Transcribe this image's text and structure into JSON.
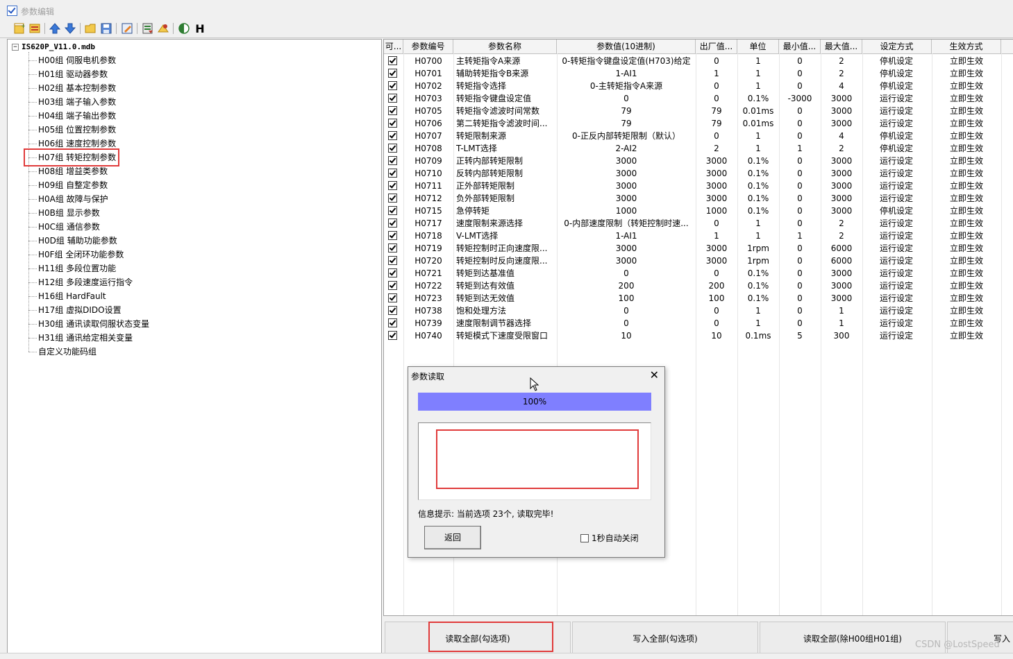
{
  "window": {
    "title": "参数编辑"
  },
  "toolbar": {
    "items": [
      "new-icon",
      "copy-icon",
      "arrow-up-icon",
      "arrow-down-icon",
      "folder-open-icon",
      "save-icon",
      "edit-icon",
      "export-icon",
      "import-icon",
      "contrast-icon"
    ],
    "h_label": "H"
  },
  "tree": {
    "root": "IS620P_V11.0.mdb",
    "expand_glyph": "−",
    "items": [
      "H00组 伺服电机参数",
      "H01组 驱动器参数",
      "H02组 基本控制参数",
      "H03组 端子输入参数",
      "H04组 端子输出参数",
      "H05组 位置控制参数",
      "H06组 速度控制参数",
      "H07组 转矩控制参数",
      "H08组 增益类参数",
      "H09组 自整定参数",
      "H0A组 故障与保护",
      "H0B组 显示参数",
      "H0C组 通信参数",
      "H0D组 辅助功能参数",
      "H0F组 全闭环功能参数",
      "H11组 多段位置功能",
      "H12组 多段速度运行指令",
      "H16组 HardFault",
      "H17组 虚拟DIDO设置",
      "H30组 通讯读取伺服状态变量",
      "H31组 通讯给定相关变量",
      "自定义功能码组"
    ],
    "highlighted_index": 7
  },
  "grid": {
    "headers": [
      "可...",
      "参数编号",
      "参数名称",
      "参数值(10进制)",
      "出厂值...",
      "单位",
      "最小值...",
      "最大值...",
      "设定方式",
      "生效方式"
    ],
    "rows": [
      [
        "H0700",
        "主转矩指令A来源",
        "0-转矩指令键盘设定值(H703)给定",
        "0",
        "1",
        "0",
        "2",
        "停机设定",
        "立即生效"
      ],
      [
        "H0701",
        "辅助转矩指令B来源",
        "1-AI1",
        "1",
        "1",
        "0",
        "2",
        "停机设定",
        "立即生效"
      ],
      [
        "H0702",
        "转矩指令选择",
        "0-主转矩指令A来源",
        "0",
        "1",
        "0",
        "4",
        "停机设定",
        "立即生效"
      ],
      [
        "H0703",
        "转矩指令键盘设定值",
        "0",
        "0",
        "0.1%",
        "-3000",
        "3000",
        "运行设定",
        "立即生效"
      ],
      [
        "H0705",
        "转矩指令滤波时间常数",
        "79",
        "79",
        "0.01ms",
        "0",
        "3000",
        "运行设定",
        "立即生效"
      ],
      [
        "H0706",
        "第二转矩指令滤波时间...",
        "79",
        "79",
        "0.01ms",
        "0",
        "3000",
        "运行设定",
        "立即生效"
      ],
      [
        "H0707",
        "转矩限制来源",
        "0-正反内部转矩限制（默认）",
        "0",
        "1",
        "0",
        "4",
        "停机设定",
        "立即生效"
      ],
      [
        "H0708",
        "T-LMT选择",
        "2-AI2",
        "2",
        "1",
        "1",
        "2",
        "停机设定",
        "立即生效"
      ],
      [
        "H0709",
        "正转内部转矩限制",
        "3000",
        "3000",
        "0.1%",
        "0",
        "3000",
        "运行设定",
        "立即生效"
      ],
      [
        "H0710",
        "反转内部转矩限制",
        "3000",
        "3000",
        "0.1%",
        "0",
        "3000",
        "运行设定",
        "立即生效"
      ],
      [
        "H0711",
        "正外部转矩限制",
        "3000",
        "3000",
        "0.1%",
        "0",
        "3000",
        "运行设定",
        "立即生效"
      ],
      [
        "H0712",
        "负外部转矩限制",
        "3000",
        "3000",
        "0.1%",
        "0",
        "3000",
        "运行设定",
        "立即生效"
      ],
      [
        "H0715",
        "急停转矩",
        "1000",
        "1000",
        "0.1%",
        "0",
        "3000",
        "停机设定",
        "立即生效"
      ],
      [
        "H0717",
        "速度限制来源选择",
        "0-内部速度限制（转矩控制时速...",
        "0",
        "1",
        "0",
        "2",
        "运行设定",
        "立即生效"
      ],
      [
        "H0718",
        "V-LMT选择",
        "1-AI1",
        "1",
        "1",
        "1",
        "2",
        "运行设定",
        "立即生效"
      ],
      [
        "H0719",
        "转矩控制时正向速度限...",
        "3000",
        "3000",
        "1rpm",
        "0",
        "6000",
        "运行设定",
        "立即生效"
      ],
      [
        "H0720",
        "转矩控制时反向速度限...",
        "3000",
        "3000",
        "1rpm",
        "0",
        "6000",
        "运行设定",
        "立即生效"
      ],
      [
        "H0721",
        "转矩到达基准值",
        "0",
        "0",
        "0.1%",
        "0",
        "3000",
        "运行设定",
        "立即生效"
      ],
      [
        "H0722",
        "转矩到达有效值",
        "200",
        "200",
        "0.1%",
        "0",
        "3000",
        "运行设定",
        "立即生效"
      ],
      [
        "H0723",
        "转矩到达无效值",
        "100",
        "100",
        "0.1%",
        "0",
        "3000",
        "运行设定",
        "立即生效"
      ],
      [
        "H0738",
        "饱和处理方法",
        "0",
        "0",
        "1",
        "0",
        "1",
        "运行设定",
        "立即生效"
      ],
      [
        "H0739",
        "速度限制调节器选择",
        "0",
        "0",
        "1",
        "0",
        "1",
        "运行设定",
        "立即生效"
      ],
      [
        "H0740",
        "转矩模式下速度受限窗口",
        "10",
        "10",
        "0.1ms",
        "5",
        "300",
        "运行设定",
        "立即生效"
      ]
    ]
  },
  "buttons": {
    "read_all_checked": "读取全部(勾选项)",
    "write_all_checked": "写入全部(勾选项)",
    "read_all_except": "读取全部(除H00组H01组)",
    "write_partial": "写入"
  },
  "dialog": {
    "title": "参数读取",
    "progress_label": "100%",
    "progress_value": 1.0,
    "message": "信息提示: 当前选项 23个, 读取完毕!",
    "back_button": "返回",
    "auto_close_label": "1秒自动关闭",
    "auto_close_checked": false,
    "close_glyph": "✕"
  },
  "watermark": "CSDN @LostSpeed",
  "colors": {
    "progress": "#7f7fff",
    "highlight": "#e03a3a"
  }
}
